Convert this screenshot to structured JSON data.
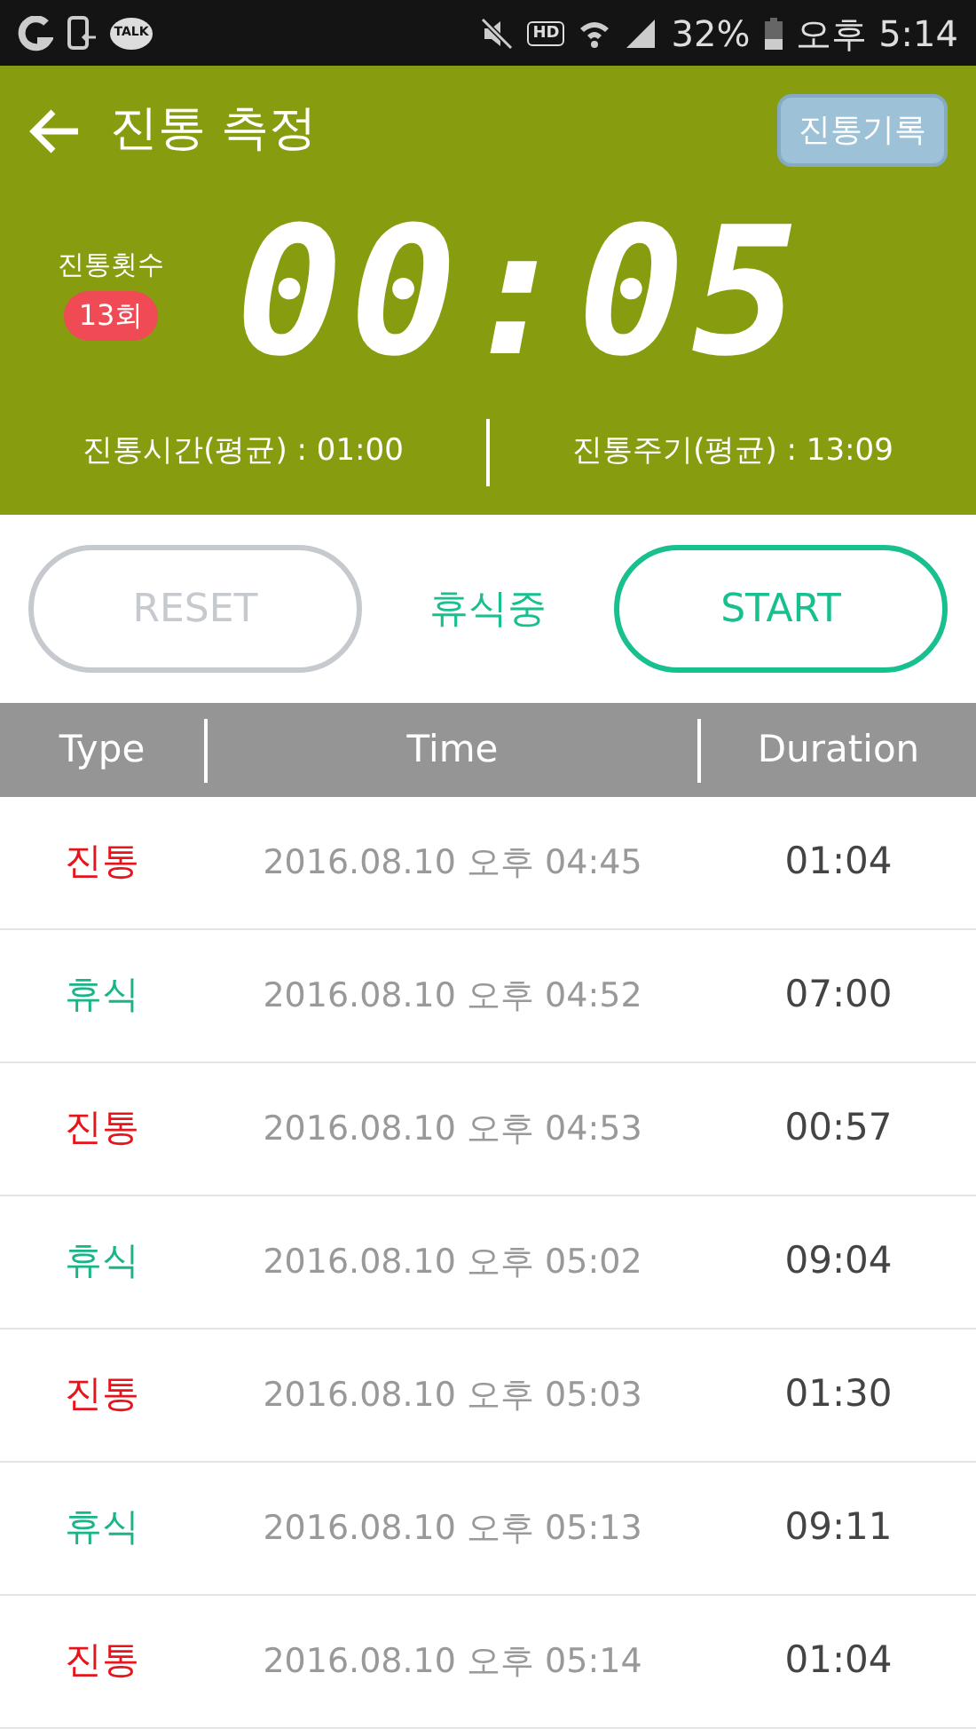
{
  "status_bar": {
    "talk_label": "TALK",
    "hd_label": "HD",
    "battery": "32%",
    "time": "오후 5:14"
  },
  "header": {
    "title": "진통 측정",
    "record_button": "진통기록",
    "count_label": "진통횟수",
    "count": "13회",
    "timer": "00:05",
    "avg_duration": "진통시간(평균) : 01:00",
    "avg_interval": "진통주기(평균) : 13:09"
  },
  "controls": {
    "reset": {
      "label": "RESET",
      "disabled": true
    },
    "state": "휴식중",
    "start": {
      "label": "START",
      "disabled": false
    }
  },
  "table": {
    "columns": [
      "Type",
      "Time",
      "Duration"
    ],
    "rows": [
      {
        "kind": "contraction",
        "type": "진통",
        "time": "2016.08.10 오후 04:45",
        "duration": "01:04"
      },
      {
        "kind": "rest",
        "type": "휴식",
        "time": "2016.08.10 오후 04:52",
        "duration": "07:00"
      },
      {
        "kind": "contraction",
        "type": "진통",
        "time": "2016.08.10 오후 04:53",
        "duration": "00:57"
      },
      {
        "kind": "rest",
        "type": "휴식",
        "time": "2016.08.10 오후 05:02",
        "duration": "09:04"
      },
      {
        "kind": "contraction",
        "type": "진통",
        "time": "2016.08.10 오후 05:03",
        "duration": "01:30"
      },
      {
        "kind": "rest",
        "type": "휴식",
        "time": "2016.08.10 오후 05:13",
        "duration": "09:11"
      },
      {
        "kind": "contraction",
        "type": "진통",
        "time": "2016.08.10 오후 05:14",
        "duration": "01:04"
      }
    ]
  }
}
